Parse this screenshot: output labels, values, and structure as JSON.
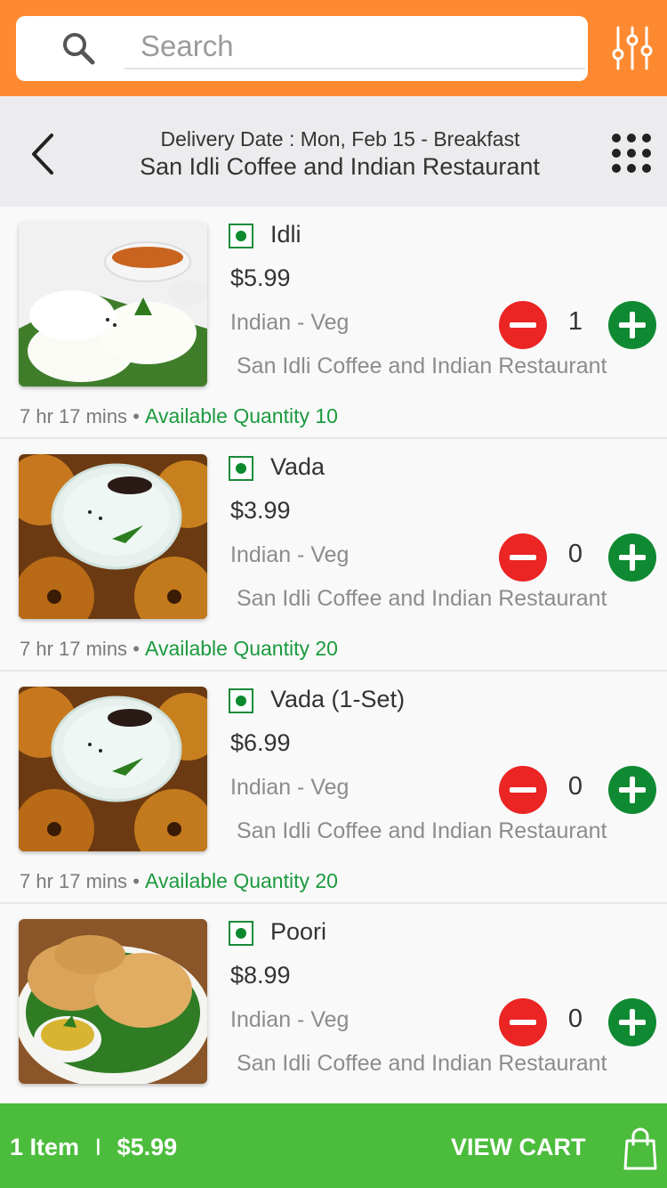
{
  "search": {
    "placeholder": "Search"
  },
  "header": {
    "subtitle": "Delivery Date : Mon, Feb 15 - Breakfast",
    "title": "San Idli Coffee and Indian Restaurant"
  },
  "items": [
    {
      "name": "Idli",
      "price": "$5.99",
      "category": "Indian - Veg",
      "restaurant": "San Idli Coffee and Indian Restaurant",
      "quantity": "1",
      "time": "7 hr 17 mins",
      "separator": "•",
      "availability": "Available Quantity 10",
      "image": "idli-with-sambar"
    },
    {
      "name": "Vada",
      "price": "$3.99",
      "category": "Indian - Veg",
      "restaurant": "San Idli Coffee and Indian Restaurant",
      "quantity": "0",
      "time": "7 hr 17 mins",
      "separator": "•",
      "availability": "Available Quantity 20",
      "image": "vada-with-chutney"
    },
    {
      "name": "Vada (1-Set)",
      "price": "$6.99",
      "category": "Indian - Veg",
      "restaurant": "San Idli Coffee and Indian Restaurant",
      "quantity": "0",
      "time": "7 hr 17 mins",
      "separator": "•",
      "availability": "Available Quantity 20",
      "image": "vada-with-chutney"
    },
    {
      "name": "Poori",
      "price": "$8.99",
      "category": "Indian - Veg",
      "restaurant": "San Idli Coffee and Indian Restaurant",
      "quantity": "0",
      "time": "",
      "separator": "",
      "availability": "",
      "image": "poori-with-potato-curry"
    }
  ],
  "cart": {
    "count_label": "1  Item",
    "divider": "I",
    "total": "$5.99",
    "view_label": "VIEW CART"
  },
  "colors": {
    "topbar": "#fd8a31",
    "bottombar": "#4cbc3c",
    "minus": "#eb2424",
    "plus": "#108a32",
    "available": "#1b9a3e"
  },
  "icons": {
    "search": "search-icon",
    "filter": "sliders-icon",
    "back": "chevron-left-icon",
    "grid": "grid-dots-icon",
    "cart": "shopping-bag-icon"
  }
}
